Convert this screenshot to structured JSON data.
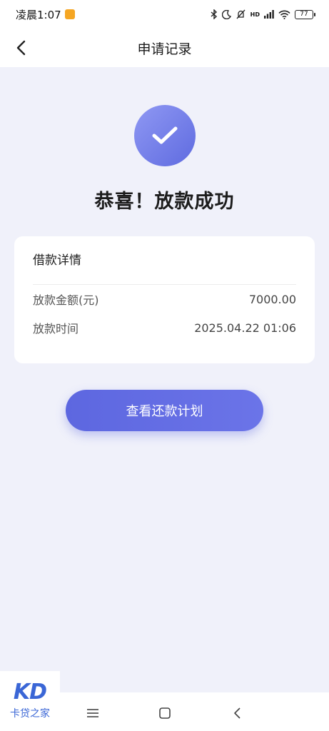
{
  "status_bar": {
    "time": "凌晨1:07",
    "battery": "77",
    "network": "HD"
  },
  "navbar": {
    "title": "申请记录"
  },
  "result": {
    "icon": "check-icon",
    "title": "恭喜！放款成功",
    "accent_color": "#6670e4"
  },
  "details": {
    "title": "借款详情",
    "rows": [
      {
        "label": "放款金额(元)",
        "value": "7000.00"
      },
      {
        "label": "放款时间",
        "value": "2025.04.22 01:06"
      }
    ]
  },
  "actions": {
    "plan_button": "查看还款计划"
  },
  "watermark": {
    "logo": "KD",
    "text": "卡贷之家"
  },
  "system_nav": {
    "menu_icon": "menu-icon",
    "home_icon": "home-icon",
    "back_icon": "back-icon"
  }
}
